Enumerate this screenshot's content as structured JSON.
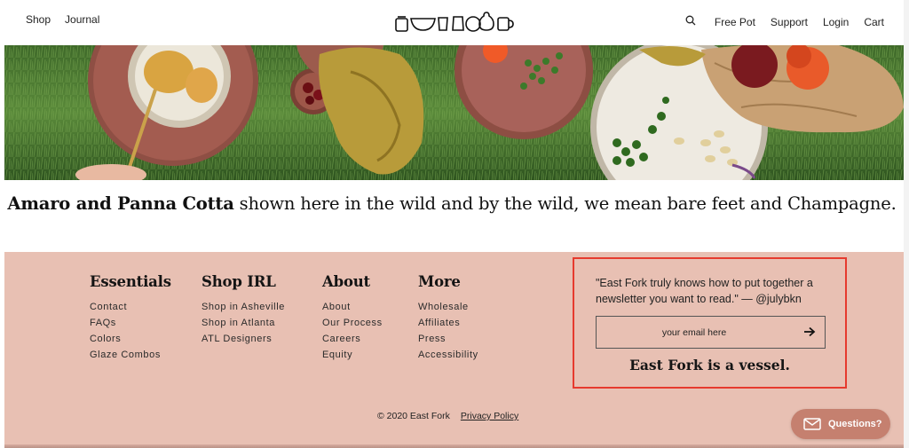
{
  "header": {
    "nav_left": [
      "Shop",
      "Journal"
    ],
    "nav_right": [
      "Free Pot",
      "Support",
      "Login",
      "Cart"
    ],
    "logo_icon": "pottery-logo-icon",
    "search_icon": "search-icon"
  },
  "hero": {
    "caption_bold": "Amaro and Panna Cotta",
    "caption_rest": " shown here in the wild and by the wild, we mean bare feet and Champagne."
  },
  "footer": {
    "columns": [
      {
        "title": "Essentials",
        "links": [
          "Contact",
          "FAQs",
          "Colors",
          "Glaze Combos"
        ]
      },
      {
        "title": "Shop IRL",
        "links": [
          "Shop in Asheville",
          "Shop in Atlanta",
          "ATL Designers"
        ]
      },
      {
        "title": "About",
        "links": [
          "About",
          "Our Process",
          "Careers",
          "Equity"
        ]
      },
      {
        "title": "More",
        "links": [
          "Wholesale",
          "Affiliates",
          "Press",
          "Accessibility"
        ]
      }
    ],
    "newsletter": {
      "quote": "\"East Fork truly knows how to put together a newsletter you want to read.\" — @julybkn",
      "email_placeholder": "your email here",
      "tagline": "East Fork is a vessel."
    },
    "copyright": "© 2020 East Fork",
    "privacy_policy": "Privacy Policy",
    "chat_button": "Questions?"
  },
  "colors": {
    "footer_bg": "#e8c0b3",
    "highlight_border": "#e63a2e",
    "chat_button_bg": "#c5806f"
  }
}
